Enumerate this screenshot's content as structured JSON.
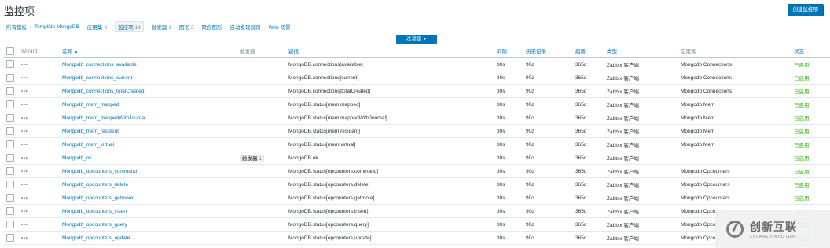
{
  "page": {
    "title": "监控项",
    "create_button": "创建监控项"
  },
  "breadcrumb": {
    "all_templates": "所有模板",
    "separator": "/",
    "template": "Template MongoDB",
    "tabs": [
      {
        "label": "应用集",
        "count": "3"
      },
      {
        "label": "监控项",
        "count": "14",
        "active": true
      },
      {
        "label": "触发器",
        "count": "1"
      },
      {
        "label": "图形",
        "count": "3"
      },
      {
        "label": "聚合图形",
        "count": ""
      },
      {
        "label": "自动发现规则",
        "count": ""
      },
      {
        "label": "Web 场景",
        "count": ""
      }
    ]
  },
  "filter": {
    "label": "过滤器"
  },
  "table": {
    "headers": {
      "wizard": "Wizard",
      "name": "名称 ▲",
      "triggers": "触发器",
      "key": "键值",
      "interval": "间隔",
      "history": "历史记录",
      "trends": "趋势",
      "type": "类型",
      "applications": "应用集",
      "status": "状态"
    },
    "rows": [
      {
        "name": "Mongodb_connections_available",
        "triggers": "",
        "key": "MongoDB.connections[available]",
        "interval": "30s",
        "history": "90d",
        "trends": "365d",
        "type": "Zabbix 客户端",
        "app": "Mongodb Connections",
        "status": "已启用"
      },
      {
        "name": "Mongodb_connections_current",
        "triggers": "",
        "key": "MongoDB.connections[current]",
        "interval": "30s",
        "history": "90d",
        "trends": "365d",
        "type": "Zabbix 客户端",
        "app": "Mongodb Connections",
        "status": "已启用"
      },
      {
        "name": "Mongodb_connections_totalCreated",
        "triggers": "",
        "key": "MongoDB.connections[totalCreated]",
        "interval": "30s",
        "history": "90d",
        "trends": "365d",
        "type": "Zabbix 客户端",
        "app": "Mongodb Connections",
        "status": "已启用"
      },
      {
        "name": "Mongodb_mem_mapped",
        "triggers": "",
        "key": "MongoDB.status[mem,mapped]",
        "interval": "30s",
        "history": "90d",
        "trends": "365d",
        "type": "Zabbix 客户端",
        "app": "Mongodb Mem",
        "status": "已启用"
      },
      {
        "name": "Mongodb_mem_mappedWithJournal",
        "triggers": "",
        "key": "MongoDB.status[mem,mappedWithJournal]",
        "interval": "30s",
        "history": "90d",
        "trends": "365d",
        "type": "Zabbix 客户端",
        "app": "Mongodb Mem",
        "status": "已启用"
      },
      {
        "name": "Mongodb_mem_resident",
        "triggers": "",
        "key": "MongoDB.status[mem,resident]",
        "interval": "30s",
        "history": "90d",
        "trends": "365d",
        "type": "Zabbix 客户端",
        "app": "Mongodb Mem",
        "status": "已启用"
      },
      {
        "name": "Mongodb_mem_virtual",
        "triggers": "",
        "key": "MongoDB.status[mem,virtual]",
        "interval": "30s",
        "history": "90d",
        "trends": "365d",
        "type": "Zabbix 客户端",
        "app": "Mongodb Mem",
        "status": "已启用"
      },
      {
        "name": "Mongodb_ok",
        "triggers": "触发器",
        "trigger_count": "1",
        "key": "MongoDB.ok",
        "interval": "30s",
        "history": "90d",
        "trends": "365d",
        "type": "Zabbix 客户端",
        "app": "",
        "status": "已启用"
      },
      {
        "name": "Mongodb_opcounters_command",
        "triggers": "",
        "key": "MongoDB.status[opcounters,command]",
        "interval": "30s",
        "history": "90d",
        "trends": "365d",
        "type": "Zabbix 客户端",
        "app": "Mongodb Opcounters",
        "status": "已启用"
      },
      {
        "name": "Mongodb_opcounters_delete",
        "triggers": "",
        "key": "MongoDB.status[opcounters,delete]",
        "interval": "30s",
        "history": "90d",
        "trends": "365d",
        "type": "Zabbix 客户端",
        "app": "Mongodb Opcounters",
        "status": "已启用"
      },
      {
        "name": "Mongodb_opcounters_getmore",
        "triggers": "",
        "key": "MongoDB.status[opcounters,getmore]",
        "interval": "30s",
        "history": "90d",
        "trends": "365d",
        "type": "Zabbix 客户端",
        "app": "Mongodb Opcounters",
        "status": "已启用"
      },
      {
        "name": "Mongodb_opcounters_insert",
        "triggers": "",
        "key": "MongoDB.status[opcounters,insert]",
        "interval": "30s",
        "history": "90d",
        "trends": "365d",
        "type": "Zabbix 客户端",
        "app": "Mongodb Opcounters",
        "status": "已启用"
      },
      {
        "name": "Mongodb_opcounters_query",
        "triggers": "",
        "key": "MongoDB.status[opcounters,query]",
        "interval": "30s",
        "history": "90d",
        "trends": "365d",
        "type": "Zabbix 客户端",
        "app": "Mongodb Opco",
        "status": "已启用"
      },
      {
        "name": "Mongodb_opcounters_update",
        "triggers": "",
        "key": "MongoDB.status[opcounters,update]",
        "interval": "30s",
        "history": "90d",
        "trends": "365d",
        "type": "Zabbix 客户端",
        "app": "Mongodb Opco",
        "status": "已启用"
      }
    ]
  },
  "watermark": {
    "cn": "创新互联",
    "en": "CHUANG XIN HU LIAN"
  },
  "icons": {
    "checkbox": "checkbox-icon",
    "menu": "more-dots-icon",
    "logo": "watermark-logo-icon"
  },
  "colors": {
    "link": "#0275b8",
    "enabled": "#3eb81c",
    "button": "#0275b8"
  }
}
